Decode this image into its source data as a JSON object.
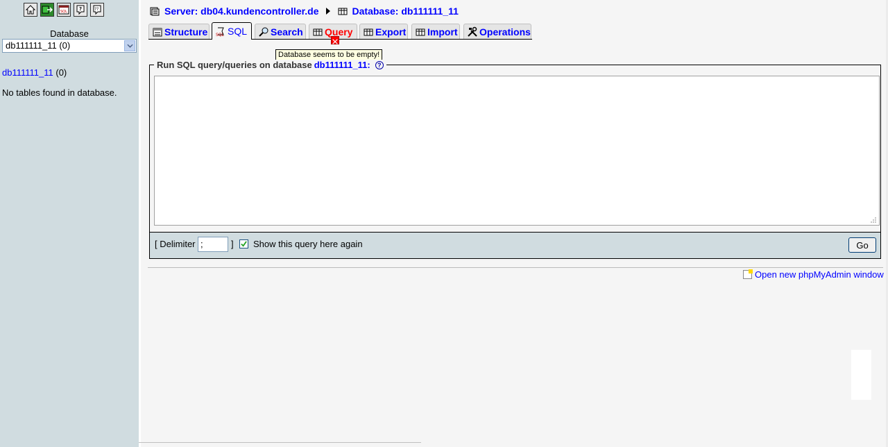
{
  "left": {
    "icons": [
      "home-icon",
      "logout-icon",
      "sql-query-window-icon",
      "documentation-icon",
      "sql-docs-icon"
    ],
    "database_label": "Database",
    "select_value": "db111111_11 (0)",
    "db_link": "db111111_11",
    "db_count": "(0)",
    "no_tables": "No tables found in database."
  },
  "breadcrumb": {
    "server": "Server: db04.kundencontroller.de",
    "database": "Database: db111111_11"
  },
  "tabs": [
    {
      "label": "Structure"
    },
    {
      "label": "SQL"
    },
    {
      "label": "Search"
    },
    {
      "label": "Query"
    },
    {
      "label": "Export"
    },
    {
      "label": "Import"
    },
    {
      "label": "Operations"
    }
  ],
  "tooltip": "Database seems to be empty!",
  "sql_panel": {
    "legend_prefix": "Run SQL query/queries on database",
    "legend_db": "db111111_11:",
    "query_text": "",
    "delimiter_label": "[ Delimiter",
    "delimiter_value": ";",
    "delimiter_close": "]",
    "show_again_label": "Show this query here again",
    "show_again_checked": true,
    "go_label": "Go"
  },
  "footer": {
    "open_window_link": "Open new phpMyAdmin window"
  },
  "colors": {
    "left_bg": "#d0dce0",
    "link": "#0000ff",
    "error": "#ff0000",
    "tooltip_bg": "#ffffe1"
  }
}
